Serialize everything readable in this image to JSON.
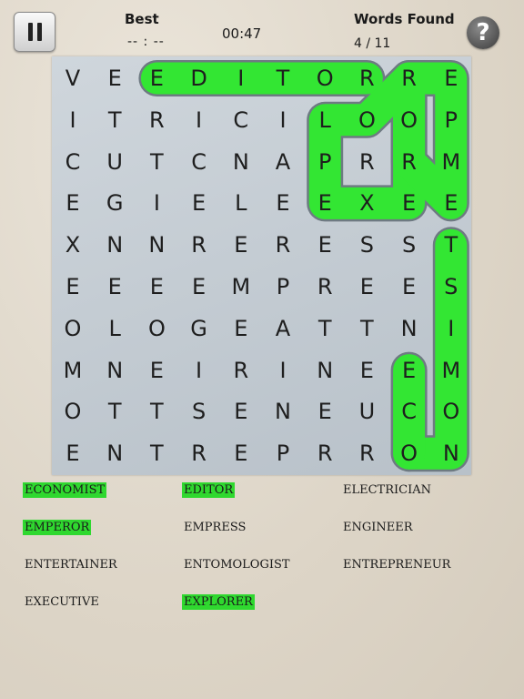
{
  "header": {
    "best_label": "Best",
    "best_value": "-- : --",
    "timer": "00:47",
    "found_label": "Words Found",
    "found_value": "4 / 11",
    "help_glyph": "?"
  },
  "icons": {
    "pause": "pause-icon",
    "help": "question-icon"
  },
  "colors": {
    "highlight": "#33e633",
    "highlight_border": "#6e7a82",
    "found_word_bg": "#2fd82f"
  },
  "grid": {
    "rows": [
      [
        "V",
        "E",
        "E",
        "D",
        "I",
        "T",
        "O",
        "R",
        "R",
        "E"
      ],
      [
        "I",
        "T",
        "R",
        "I",
        "C",
        "I",
        "L",
        "O",
        "O",
        "P"
      ],
      [
        "C",
        "U",
        "T",
        "C",
        "N",
        "A",
        "P",
        "R",
        "R",
        "M"
      ],
      [
        "E",
        "G",
        "I",
        "E",
        "L",
        "E",
        "E",
        "X",
        "E",
        "E"
      ],
      [
        "X",
        "N",
        "N",
        "R",
        "E",
        "R",
        "E",
        "S",
        "S",
        "T"
      ],
      [
        "E",
        "E",
        "E",
        "E",
        "M",
        "P",
        "R",
        "E",
        "E",
        "S"
      ],
      [
        "O",
        "L",
        "O",
        "G",
        "E",
        "A",
        "T",
        "T",
        "N",
        "I"
      ],
      [
        "M",
        "N",
        "E",
        "I",
        "R",
        "I",
        "N",
        "E",
        "E",
        "M"
      ],
      [
        "O",
        "T",
        "T",
        "S",
        "E",
        "N",
        "E",
        "U",
        "C",
        "O"
      ],
      [
        "E",
        "N",
        "T",
        "R",
        "E",
        "P",
        "R",
        "R",
        "O",
        "N"
      ]
    ],
    "found_paths": [
      {
        "word": "EDITOR",
        "cells": [
          [
            0,
            2
          ],
          [
            0,
            3
          ],
          [
            0,
            4
          ],
          [
            0,
            5
          ],
          [
            0,
            6
          ],
          [
            0,
            7
          ]
        ]
      },
      {
        "word": "EXPLORER",
        "cells": [
          [
            3,
            6
          ],
          [
            3,
            7
          ],
          [
            3,
            8
          ],
          [
            2,
            8
          ],
          [
            1,
            8
          ],
          [
            0,
            8
          ],
          [
            1,
            7
          ],
          [
            1,
            6
          ],
          [
            2,
            6
          ],
          [
            3,
            6
          ]
        ]
      },
      {
        "word": "EMPEROR",
        "cells": [
          [
            0,
            9
          ],
          [
            1,
            9
          ],
          [
            2,
            9
          ],
          [
            3,
            9
          ],
          [
            2,
            8
          ],
          [
            1,
            8
          ],
          [
            0,
            8
          ],
          [
            0,
            9
          ]
        ]
      },
      {
        "word": "ECONOMIST",
        "cells": [
          [
            9,
            8
          ],
          [
            9,
            9
          ],
          [
            8,
            9
          ],
          [
            7,
            9
          ],
          [
            6,
            9
          ],
          [
            5,
            9
          ],
          [
            4,
            9
          ]
        ]
      },
      {
        "word": "ECONOMIST_2",
        "cells": [
          [
            7,
            8
          ],
          [
            8,
            8
          ],
          [
            9,
            8
          ]
        ]
      }
    ]
  },
  "words": [
    {
      "label": "ECONOMIST",
      "found": true
    },
    {
      "label": "EDITOR",
      "found": true
    },
    {
      "label": "ELECTRICIAN",
      "found": false
    },
    {
      "label": "EMPEROR",
      "found": true
    },
    {
      "label": "EMPRESS",
      "found": false
    },
    {
      "label": "ENGINEER",
      "found": false
    },
    {
      "label": "ENTERTAINER",
      "found": false
    },
    {
      "label": "ENTOMOLOGIST",
      "found": false
    },
    {
      "label": "ENTREPRENEUR",
      "found": false
    },
    {
      "label": "EXECUTIVE",
      "found": false
    },
    {
      "label": "EXPLORER",
      "found": true
    }
  ]
}
